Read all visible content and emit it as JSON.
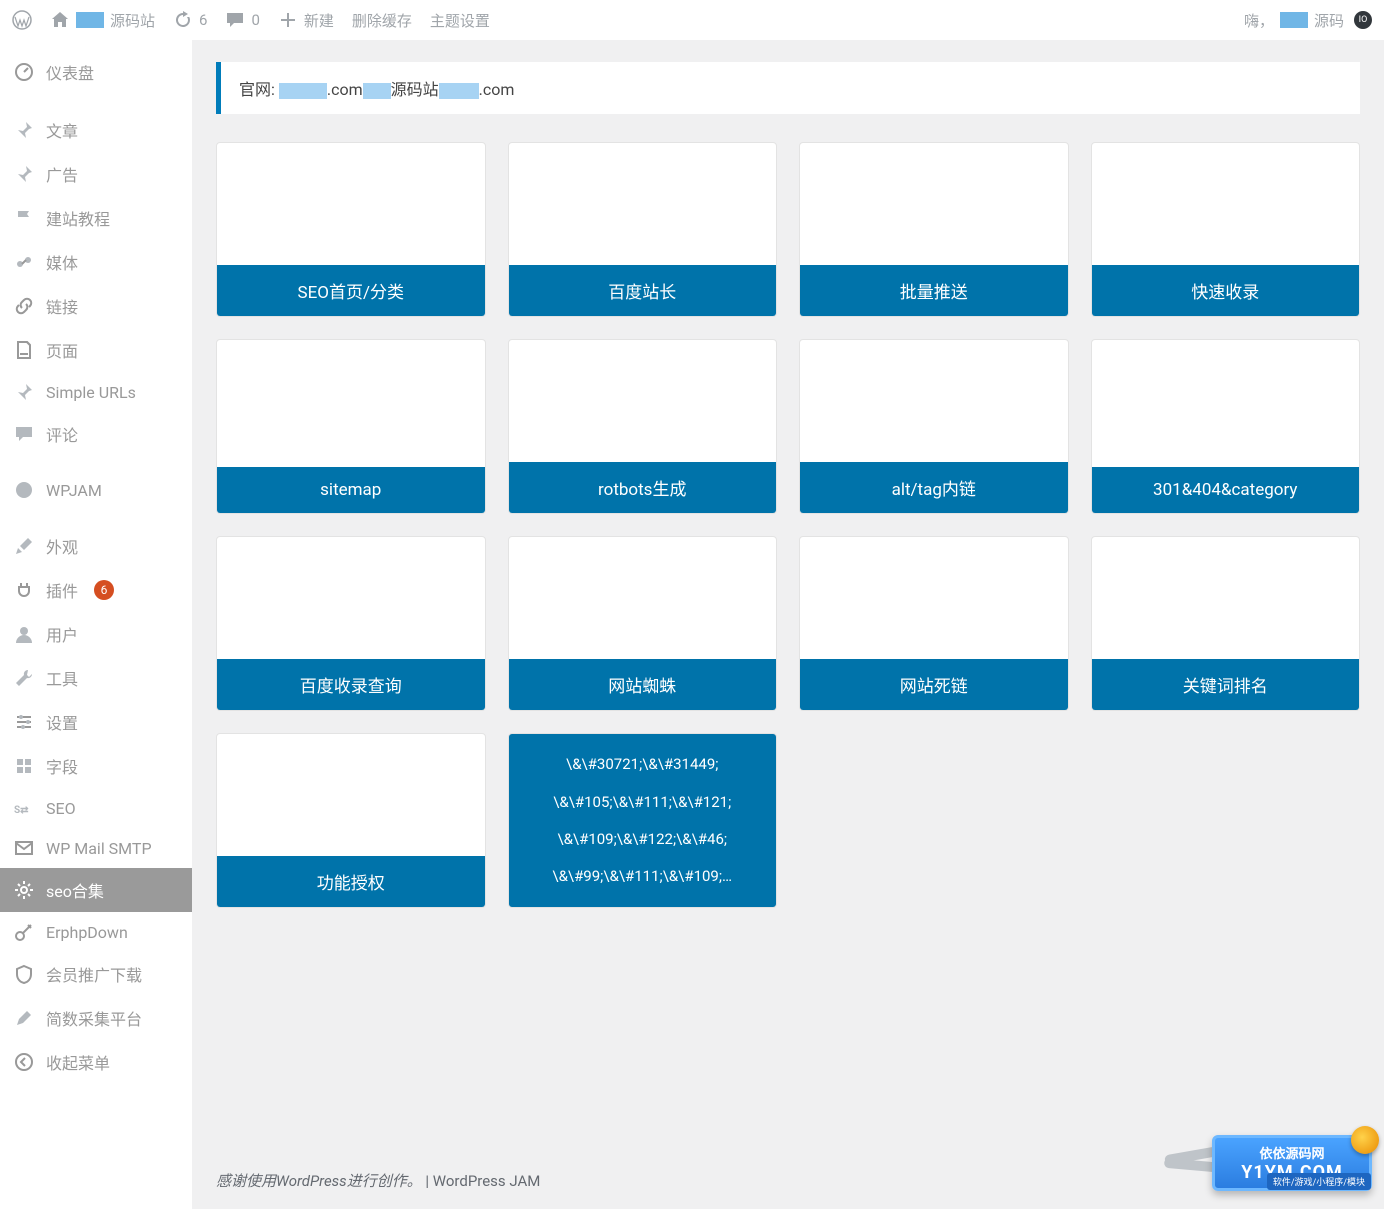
{
  "adminbar": {
    "site_name_suffix": "源码站",
    "updates_count": "6",
    "comments_count": "0",
    "new_label": "新建",
    "clear_cache": "删除缓存",
    "theme_settings": "主题设置",
    "greeting_prefix": "嗨，",
    "greeting_suffix": "源码"
  },
  "menu": [
    {
      "label": "仪表盘",
      "icon": "dashboard"
    },
    {
      "sep": true
    },
    {
      "label": "文章",
      "icon": "pin"
    },
    {
      "label": "广告",
      "icon": "pin"
    },
    {
      "label": "建站教程",
      "icon": "flag"
    },
    {
      "label": "媒体",
      "icon": "media"
    },
    {
      "label": "链接",
      "icon": "link"
    },
    {
      "label": "页面",
      "icon": "page"
    },
    {
      "label": "Simple URLs",
      "icon": "pin"
    },
    {
      "label": "评论",
      "icon": "comment"
    },
    {
      "sep": true
    },
    {
      "label": "WPJAM",
      "icon": "wpjam"
    },
    {
      "sep": true
    },
    {
      "label": "外观",
      "icon": "brush"
    },
    {
      "label": "插件",
      "icon": "plug",
      "badge": "6"
    },
    {
      "label": "用户",
      "icon": "user"
    },
    {
      "label": "工具",
      "icon": "wrench"
    },
    {
      "label": "设置",
      "icon": "sliders"
    },
    {
      "label": "字段",
      "icon": "grid"
    },
    {
      "label": "SEO",
      "icon": "seo"
    },
    {
      "label": "WP Mail SMTP",
      "icon": "mail"
    },
    {
      "label": "seo合集",
      "icon": "gear",
      "current": true
    },
    {
      "label": "ErphpDown",
      "icon": "key"
    },
    {
      "label": "会员推广下载",
      "icon": "shield"
    },
    {
      "label": "简数采集平台",
      "icon": "pen"
    },
    {
      "label": "收起菜单",
      "icon": "collapse"
    }
  ],
  "notice": {
    "prefix": "官网: ",
    "mid1": ".com",
    "mid2": "源码站",
    "suffix": ".com"
  },
  "cards": [
    {
      "label": "SEO首页/分类"
    },
    {
      "label": "百度站长"
    },
    {
      "label": "批量推送"
    },
    {
      "label": "快速收录"
    },
    {
      "label": "sitemap"
    },
    {
      "label": "rotbots生成"
    },
    {
      "label": "alt/tag内链"
    },
    {
      "label": "301&404&category"
    },
    {
      "label": "百度收录查询"
    },
    {
      "label": "网站蜘蛛"
    },
    {
      "label": "网站死链"
    },
    {
      "label": "关键词排名"
    },
    {
      "label": "功能授权"
    },
    {
      "filled": true,
      "lines": [
        "\\&\\#30721;\\&\\#31449;",
        "\\&\\#105;\\&\\#111;\\&\\#121;",
        "\\&\\#109;\\&\\#122;\\&\\#46;",
        "\\&\\#99;\\&\\#111;\\&\\#109;…"
      ]
    }
  ],
  "footer": {
    "thanks_prefix": "感谢使用",
    "wp": "WordPress",
    "thanks_suffix": "进行创作。",
    "pipe": " | ",
    "jam": "WordPress JAM"
  },
  "watermark": {
    "line1": "依依源码网",
    "line2": "Y1YM.COM",
    "sub": "软件/游戏/小程序/模块"
  }
}
